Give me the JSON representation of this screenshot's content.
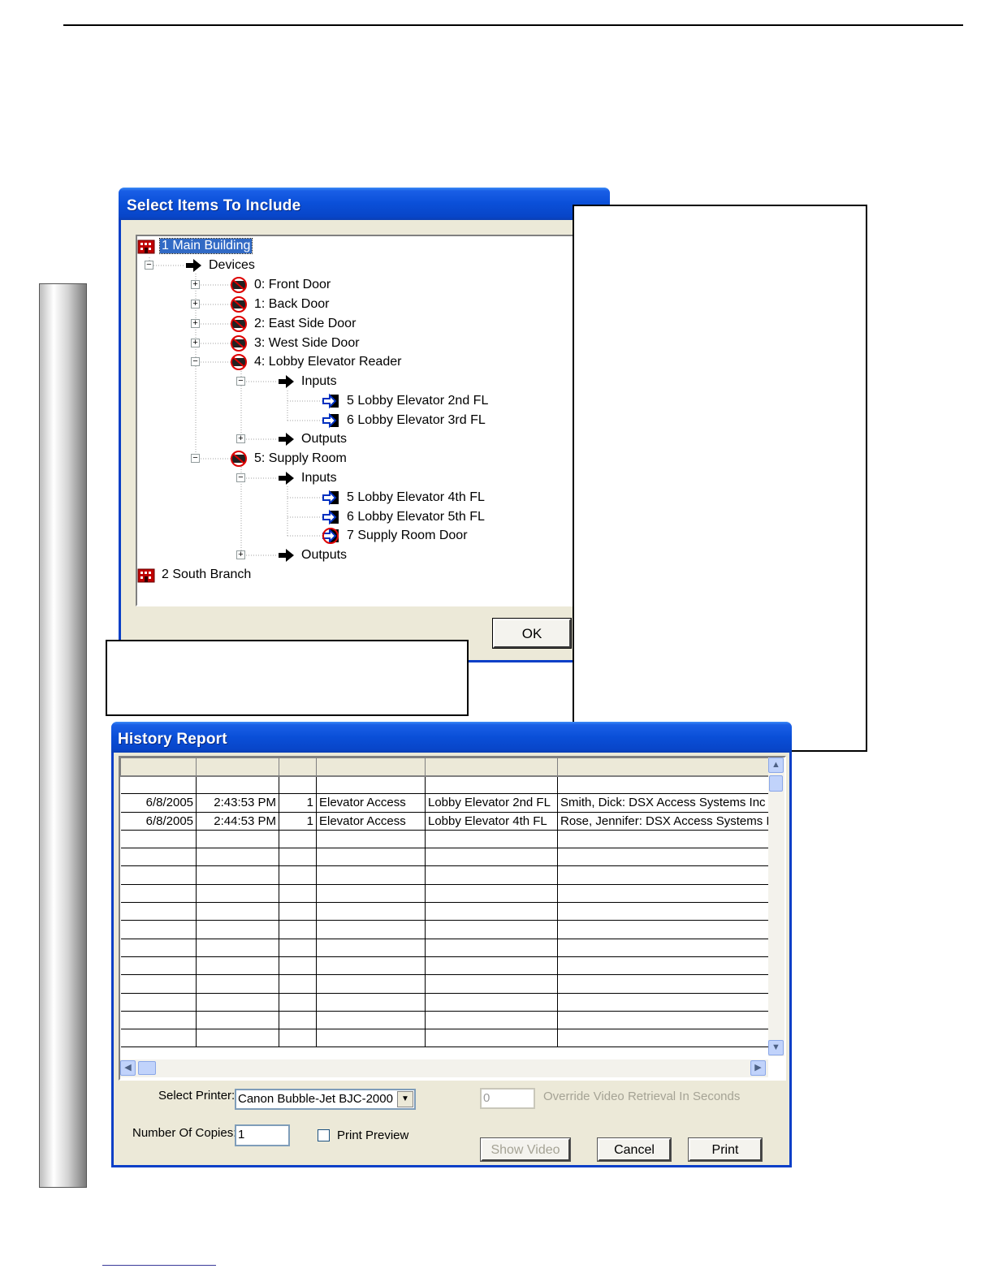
{
  "select_dialog": {
    "title": "Select Items To Include",
    "ok_label": "OK",
    "tree": {
      "building1": "1  Main Building",
      "devices": "Devices",
      "d0": "0: Front Door",
      "d1": "1: Back Door",
      "d2": "2: East Side Door",
      "d3": "3: West Side Door",
      "d4": "4: Lobby Elevator Reader",
      "d4_inputs": "Inputs",
      "d4_in5": "5  Lobby Elevator 2nd FL",
      "d4_in6": "6  Lobby Elevator 3rd FL",
      "d4_outputs": "Outputs",
      "d5": "5: Supply Room",
      "d5_inputs": "Inputs",
      "d5_in5": "5  Lobby Elevator 4th FL",
      "d5_in6": "6  Lobby Elevator 5th FL",
      "d5_in7": "7  Supply Room Door",
      "d5_outputs": "Outputs",
      "building2": "2  South Branch"
    }
  },
  "history_dialog": {
    "title": "History Report",
    "rows": [
      {
        "date": "6/8/2005",
        "time": "2:43:53 PM",
        "n": "1",
        "event": "Elevator Access",
        "location": "Lobby Elevator 2nd FL",
        "person": "Smith, Dick: DSX Access Systems Inc"
      },
      {
        "date": "6/8/2005",
        "time": "2:44:53 PM",
        "n": "1",
        "event": "Elevator Access",
        "location": "Lobby Elevator 4th FL",
        "person": "Rose, Jennifer: DSX Access Systems I"
      }
    ],
    "select_printer_label": "Select Printer:",
    "printer_value": "Canon Bubble-Jet BJC-2000",
    "override_value": "0",
    "override_label": "Override Video Retrieval In Seconds",
    "copies_label": "Number Of Copies:",
    "copies_value": "1",
    "print_preview_label": "Print Preview",
    "show_video_label": "Show Video",
    "cancel_label": "Cancel",
    "print_label": "Print"
  }
}
